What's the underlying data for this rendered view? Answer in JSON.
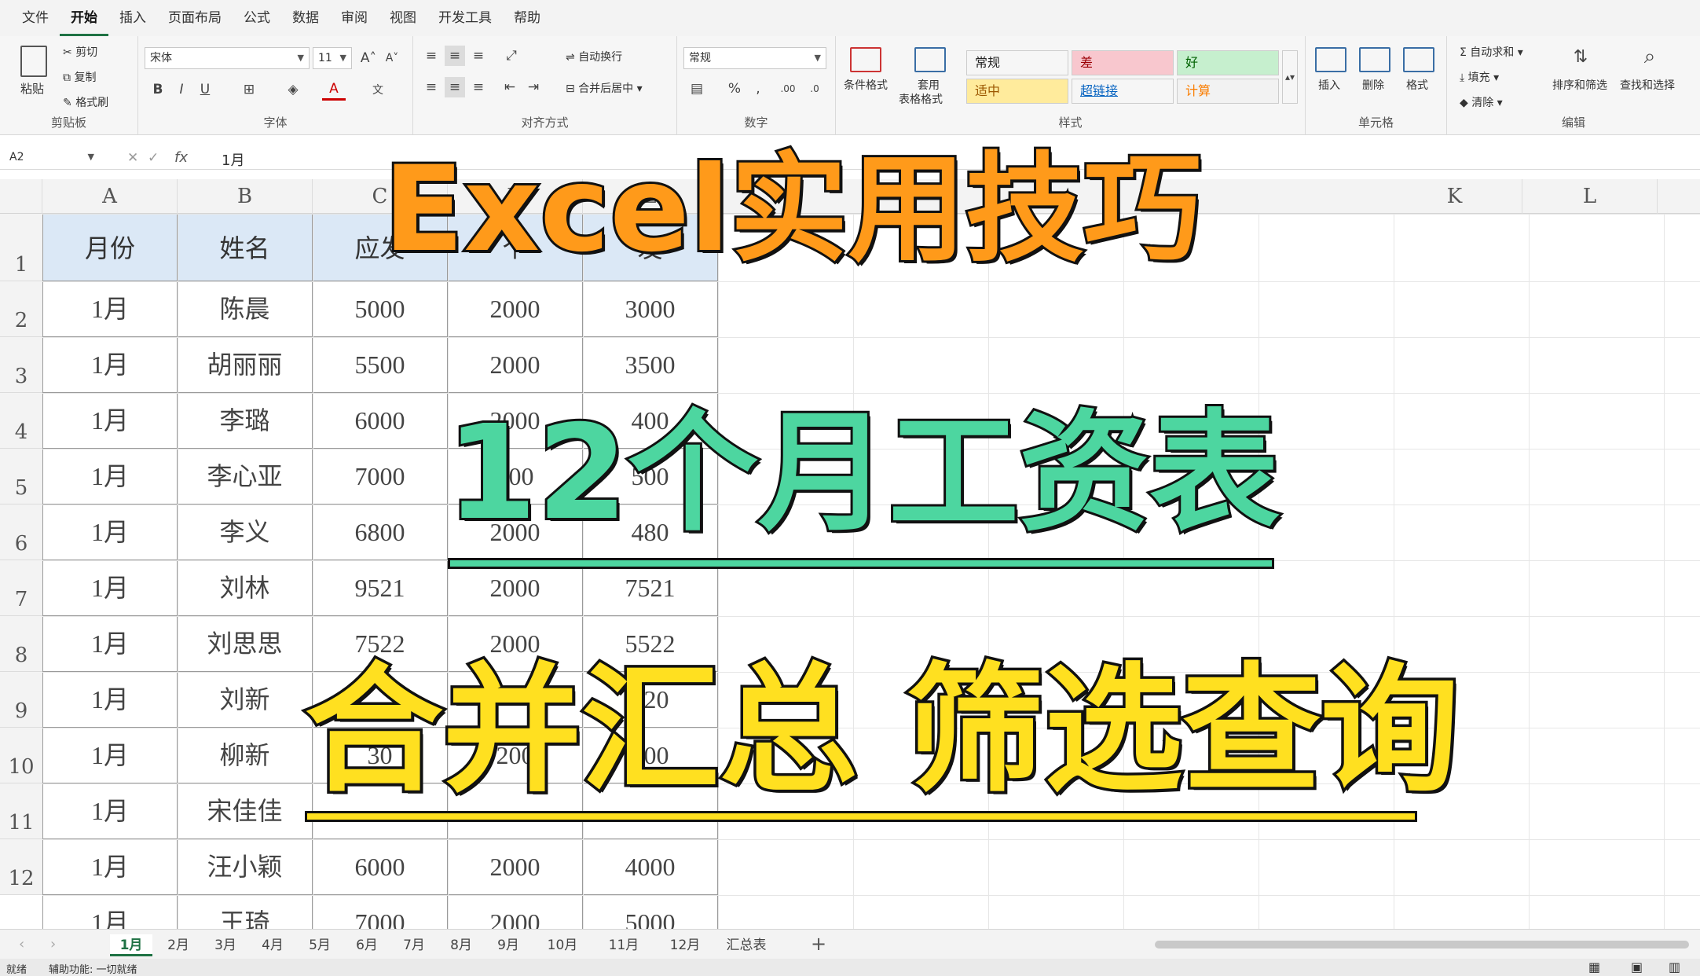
{
  "menu": [
    "文件",
    "开始",
    "插入",
    "页面布局",
    "公式",
    "数据",
    "审阅",
    "视图",
    "开发工具",
    "帮助"
  ],
  "ribbon": {
    "clipboard": {
      "paste": "粘贴",
      "cut": "剪切",
      "copy": "复制",
      "format_painter": "格式刷",
      "label": "剪贴板"
    },
    "font": {
      "name": "宋体",
      "size": "11",
      "label": "字体"
    },
    "alignment": {
      "wrap": "自动换行",
      "merge": "合并后居中",
      "label": "对齐方式"
    },
    "number": {
      "format": "常规",
      "label": "数字"
    },
    "styles_group": {
      "conditional": "条件格式",
      "table_format_1": "套用",
      "table_format_2": "表格格式",
      "label": "样式",
      "cells": [
        {
          "text": "常规",
          "bg": "#ffffff",
          "fg": "#222222"
        },
        {
          "text": "差",
          "bg": "#f8c7ce",
          "fg": "#9c0006"
        },
        {
          "text": "好",
          "bg": "#c6efce",
          "fg": "#006100"
        },
        {
          "text": "适中",
          "bg": "#ffeb9c",
          "fg": "#9c5700"
        },
        {
          "text": "超链接",
          "bg": "#ffffff",
          "fg": "#0563c1"
        },
        {
          "text": "计算",
          "bg": "#f2f2f2",
          "fg": "#fa7d00"
        }
      ]
    },
    "cells_group": {
      "insert": "插入",
      "delete": "删除",
      "format": "格式",
      "label": "单元格"
    },
    "editing": {
      "autosum": "自动求和",
      "fill": "填充",
      "clear": "清除",
      "sort": "排序和筛选",
      "find": "查找和选择",
      "label": "编辑"
    }
  },
  "formula_bar": {
    "name_box": "A2",
    "fx": "fx",
    "value": "1月"
  },
  "columns": [
    "A",
    "B",
    "C",
    "D",
    "E",
    "K",
    "L"
  ],
  "rows": [
    "1",
    "2",
    "3",
    "4",
    "5",
    "6",
    "7",
    "8",
    "9",
    "10",
    "11",
    "12"
  ],
  "table": {
    "headers": [
      "月份",
      "姓名",
      "应发",
      "个",
      "发"
    ],
    "data": [
      [
        "1月",
        "陈晨",
        "5000",
        "2000",
        "3000"
      ],
      [
        "1月",
        "胡丽丽",
        "5500",
        "2000",
        "3500"
      ],
      [
        "1月",
        "李璐",
        "6000",
        "2000",
        "400"
      ],
      [
        "1月",
        "李心亚",
        "7000",
        "000",
        "500"
      ],
      [
        "1月",
        "李义",
        "6800",
        "2000",
        "480"
      ],
      [
        "1月",
        "刘林",
        "9521",
        "2000",
        "7521"
      ],
      [
        "1月",
        "刘思思",
        "7522",
        "2000",
        "5522"
      ],
      [
        "1月",
        "刘新",
        "",
        "",
        "020"
      ],
      [
        "1月",
        "柳新",
        "30",
        "200",
        "000"
      ],
      [
        "1月",
        "宋佳佳",
        "",
        "",
        ""
      ],
      [
        "1月",
        "汪小颖",
        "6000",
        "2000",
        "4000"
      ],
      [
        "1月",
        "王琦",
        "7000",
        "2000",
        "5000"
      ]
    ]
  },
  "overlay": {
    "line1": "Excel实用技巧",
    "line2": "12个月工资表",
    "line3": "合并汇总  筛选查询"
  },
  "sheet_tabs": [
    "1月",
    "2月",
    "3月",
    "4月",
    "5月",
    "6月",
    "7月",
    "8月",
    "9月",
    "10月",
    "11月",
    "12月",
    "汇总表"
  ],
  "add_sheet": "+",
  "status": {
    "ready": "就绪",
    "accessibility": "辅助功能: 一切就绪"
  }
}
